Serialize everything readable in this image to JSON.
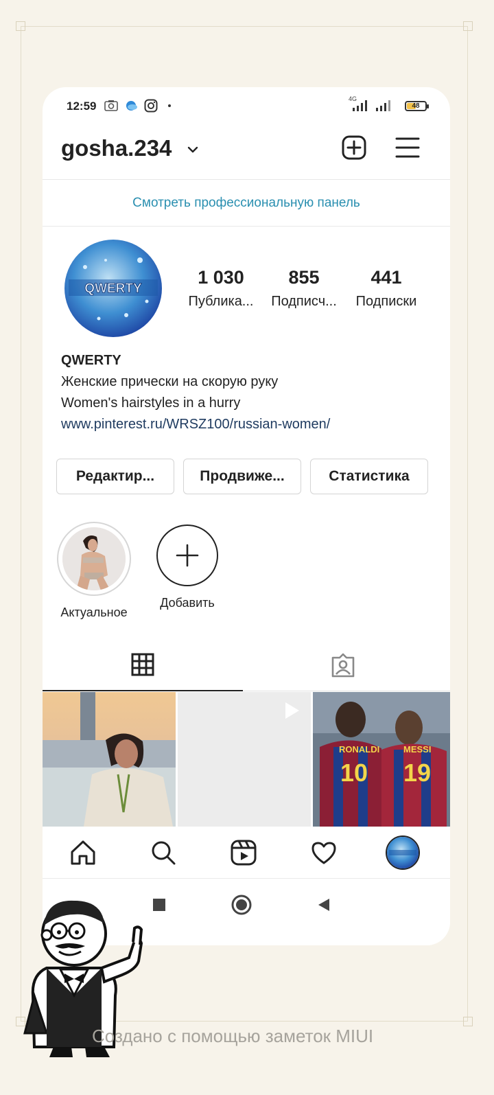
{
  "status_bar": {
    "time": "12:59",
    "network": "4G",
    "battery": "48",
    "battery_level_pct": 48,
    "icons": [
      "screenshot-icon",
      "weather-icon",
      "instagram-icon",
      "dot-icon",
      "signal-icon",
      "signal-icon",
      "battery-icon"
    ]
  },
  "header": {
    "username": "gosha.234",
    "icons": [
      "chevron-down-icon",
      "new-post-icon",
      "menu-icon"
    ]
  },
  "pro_dashboard_link": "Смотреть профессиональную панель",
  "profile": {
    "avatar_text": "QWERTY",
    "stats": [
      {
        "value": "1 030",
        "label": "Публика..."
      },
      {
        "value": "855",
        "label": "Подписч..."
      },
      {
        "value": "441",
        "label": "Подписки"
      }
    ],
    "name": "QWERTY",
    "bio_line1": "Женские прически на скорую руку",
    "bio_line2": "Women's hairstyles in a hurry",
    "website": "www.pinterest.ru/WRSZ100/russian-women/"
  },
  "buttons": {
    "edit": "Редактир...",
    "promote": "Продвиже...",
    "stats": "Статистика"
  },
  "highlights": [
    {
      "label": "Актуальное"
    },
    {
      "label": "Добавить"
    }
  ],
  "tabs": [
    "grid-icon",
    "tagged-icon"
  ],
  "grid_posts": [
    {
      "jersey": ""
    },
    {
      "jersey": ""
    },
    {
      "jersey_left_name": "RONALDI",
      "jersey_left_num": "10",
      "jersey_right_name": "MESSI",
      "jersey_right_num": "19"
    }
  ],
  "bottom_nav": [
    "home-icon",
    "search-icon",
    "reels-icon",
    "heart-icon",
    "profile-icon"
  ],
  "system_nav": [
    "recents-icon",
    "home-button-icon",
    "back-icon"
  ],
  "footer": "Создано с помощью заметок MIUI",
  "colors": {
    "link_blue": "#2a8fb0",
    "text": "#222222",
    "note_bg": "#f7f3ea"
  }
}
